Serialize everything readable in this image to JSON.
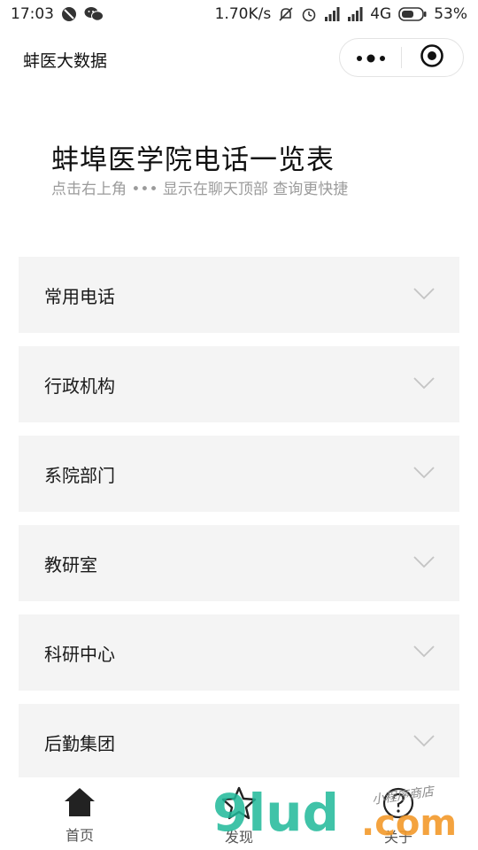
{
  "status_bar": {
    "time": "17:03",
    "net_speed": "1.70K/s",
    "network_type": "4G",
    "battery": "53%",
    "icons": [
      "block-icon",
      "wechat-icon",
      "mute-icon",
      "alarm-icon",
      "signal-icon",
      "signal-icon",
      "battery-icon"
    ]
  },
  "nav": {
    "title": "蚌医大数据",
    "menu_icon": "more-dots-icon",
    "close_icon": "target-circle-icon"
  },
  "header": {
    "title": "蚌埠医学院电话一览表",
    "subtitle": "点击右上角 ••• 显示在聊天顶部 查询更快捷"
  },
  "categories": [
    {
      "label": "常用电话"
    },
    {
      "label": "行政机构"
    },
    {
      "label": "系院部门"
    },
    {
      "label": "教研室"
    },
    {
      "label": "科研中心"
    },
    {
      "label": "后勤集团"
    }
  ],
  "tabs": [
    {
      "label": "首页",
      "icon": "home-icon"
    },
    {
      "label": "发现",
      "icon": "star-icon"
    },
    {
      "label": "关于",
      "icon": "question-icon"
    }
  ],
  "watermark": {
    "brand": "9lud",
    "suffix": ".com",
    "caption": "小程序商店"
  },
  "colors": {
    "row_bg": "#f4f4f4",
    "subtitle": "#9b9b9b",
    "chevron": "#c4c4c4",
    "watermark_green": "#1fb99a",
    "watermark_orange": "#f39a2b"
  }
}
